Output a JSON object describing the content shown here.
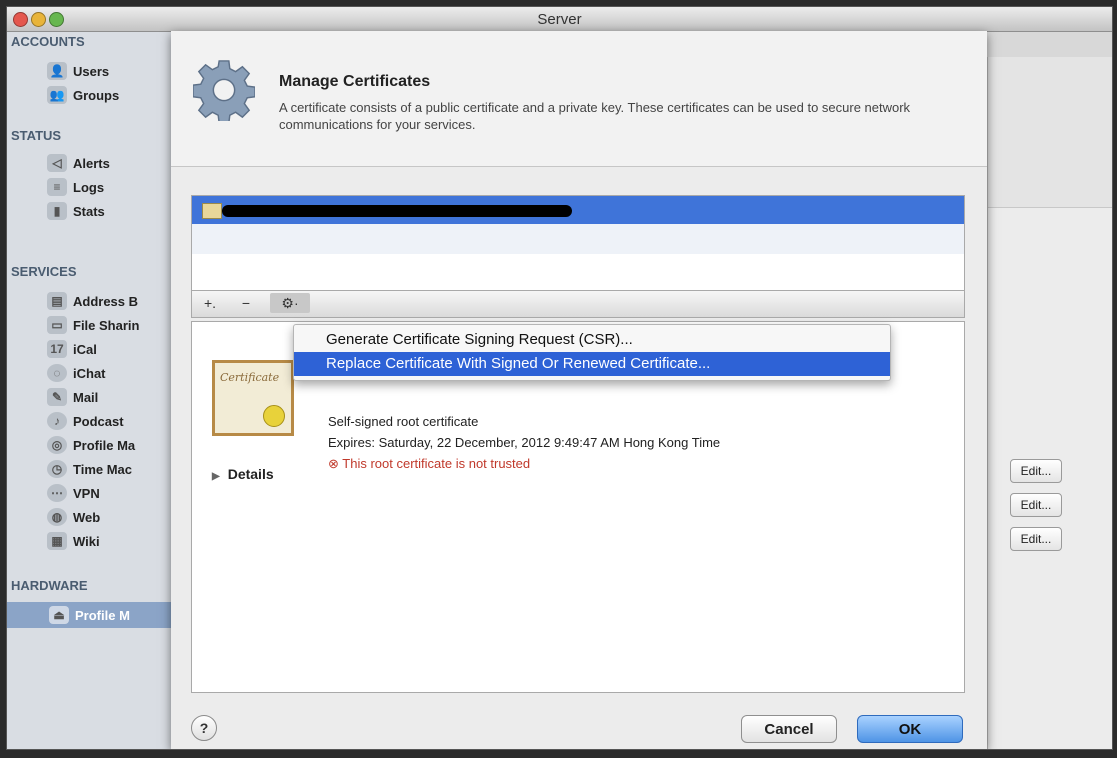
{
  "window": {
    "title": "Server"
  },
  "sidebar": {
    "sections": [
      {
        "label": "ACCOUNTS",
        "items": [
          {
            "label": "Users",
            "icon": "user-icon"
          },
          {
            "label": "Groups",
            "icon": "group-icon"
          }
        ]
      },
      {
        "label": "STATUS",
        "items": [
          {
            "label": "Alerts",
            "icon": "alert-icon"
          },
          {
            "label": "Logs",
            "icon": "log-icon"
          },
          {
            "label": "Stats",
            "icon": "stats-icon"
          }
        ]
      },
      {
        "label": "SERVICES",
        "items": [
          {
            "label": "Address B",
            "icon": "address-book-icon"
          },
          {
            "label": "File Sharin",
            "icon": "file-sharing-icon"
          },
          {
            "label": "iCal",
            "icon": "calendar-icon"
          },
          {
            "label": "iChat",
            "icon": "chat-icon"
          },
          {
            "label": "Mail",
            "icon": "mail-icon"
          },
          {
            "label": "Podcast",
            "icon": "podcast-icon"
          },
          {
            "label": "Profile Ma",
            "icon": "profile-manager-icon"
          },
          {
            "label": "Time Mac",
            "icon": "time-machine-icon"
          },
          {
            "label": "VPN",
            "icon": "vpn-icon"
          },
          {
            "label": "Web",
            "icon": "web-icon"
          },
          {
            "label": "Wiki",
            "icon": "wiki-icon"
          }
        ]
      },
      {
        "label": "HARDWARE",
        "items": [
          {
            "label": "Profile M",
            "icon": "server-icon",
            "selected": true
          }
        ]
      }
    ]
  },
  "sheet": {
    "title": "Manage Certificates",
    "description": "A certificate consists of a public certificate and a private key. These certificates can be used to secure network communications for your services.",
    "toolbar": {
      "add": "+.",
      "remove": "−",
      "action": "⚙·"
    },
    "menu": [
      "Generate Certificate Signing Request (CSR)...",
      "Replace Certificate With Signed Or Renewed Certificate..."
    ],
    "cert": {
      "line1": "Self-signed root certificate",
      "line2": "Expires: Saturday, 22 December, 2012 9:49:47 AM Hong Kong Time",
      "warning": "This root certificate is not trusted",
      "details": "Details",
      "image_text": "Certificate"
    },
    "help": "?",
    "cancel": "Cancel",
    "ok": "OK"
  },
  "right_panel": {
    "edit_buttons": [
      "Edit...",
      "Edit...",
      "Edit..."
    ]
  },
  "colors": {
    "selection": "#3f74d9",
    "menu_highlight": "#2e62d6",
    "warning": "#c0392b",
    "ok_button": "#4f94e6"
  }
}
